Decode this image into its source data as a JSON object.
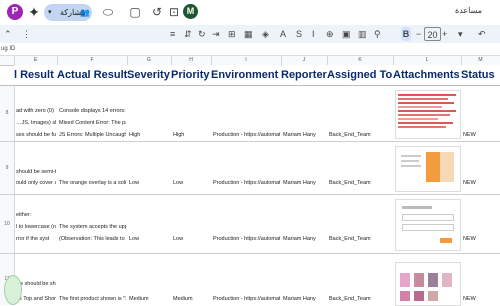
{
  "topbar": {
    "gem_letter": "P",
    "share_label": "مشاركة",
    "avatar_letter": "M",
    "title_rtl": "مساعدة",
    "icons": [
      "sparkle-icon",
      "share-people-icon",
      "meet-icon",
      "chat-icon",
      "history-icon",
      "lock-icon"
    ]
  },
  "toolbar": {
    "bold": "B",
    "font_size": "20",
    "minus": "−",
    "plus": "+"
  },
  "namebox": {
    "value": "ug ID"
  },
  "columns": [
    "E",
    "F",
    "G",
    "H",
    "I",
    "J",
    "K",
    "L",
    "M"
  ],
  "headers": {
    "expected": "l Result",
    "actual": "Actual Result",
    "severity": "Severity",
    "priority": "Priority",
    "environment": "Environment",
    "reporter": "Reporter",
    "assigned": "Assigned To",
    "attachments": "Attachments",
    "status": "Status"
  },
  "rows": [
    {
      "num": "8",
      "expected": [
        "ad with zero (0)",
        "…JS, Images) sh",
        "ses should be fu"
      ],
      "actual": [
        "Console displays 14 errors:",
        "Mixed Content Error: The pag",
        "JS Errors: Multiple Uncaught"
      ],
      "severity": "High",
      "priority": "High",
      "environment": "Production - https://automati",
      "reporter": "Mariam Hany",
      "assigned": "Back_End_Team",
      "status": "NEW"
    },
    {
      "num": "9",
      "expected": [
        "should be semi-t",
        "ould only cover a"
      ],
      "actual": [
        "The orange overlay is a solid"
      ],
      "severity": "Low",
      "priority": "Low",
      "environment": "Production - https://automati",
      "reporter": "Mariam Hany",
      "assigned": "Back_End_Team",
      "status": "NEW"
    },
    {
      "num": "10",
      "expected": [
        "either:",
        "l to lowercase (n",
        "rror if the syst"
      ],
      "actual": [
        "The system accepts the uppe",
        "(Observation: This leads to in"
      ],
      "severity": "Low",
      "priority": "Low",
      "environment": "Production - https://automati",
      "reporter": "Mariam Hany",
      "assigned": "Back_End_Team",
      "status": "NEW"
    },
    {
      "num": "11",
      "expected": [
        "cts should be sh",
        "es Top and Shor"
      ],
      "actual": [
        "The first product shown is \"Se"
      ],
      "severity": "Medium",
      "priority": "Medium",
      "environment": "Production - https://automati",
      "reporter": "Mariam Hany",
      "assigned": "Back_End_Team",
      "status": "NEW"
    }
  ]
}
